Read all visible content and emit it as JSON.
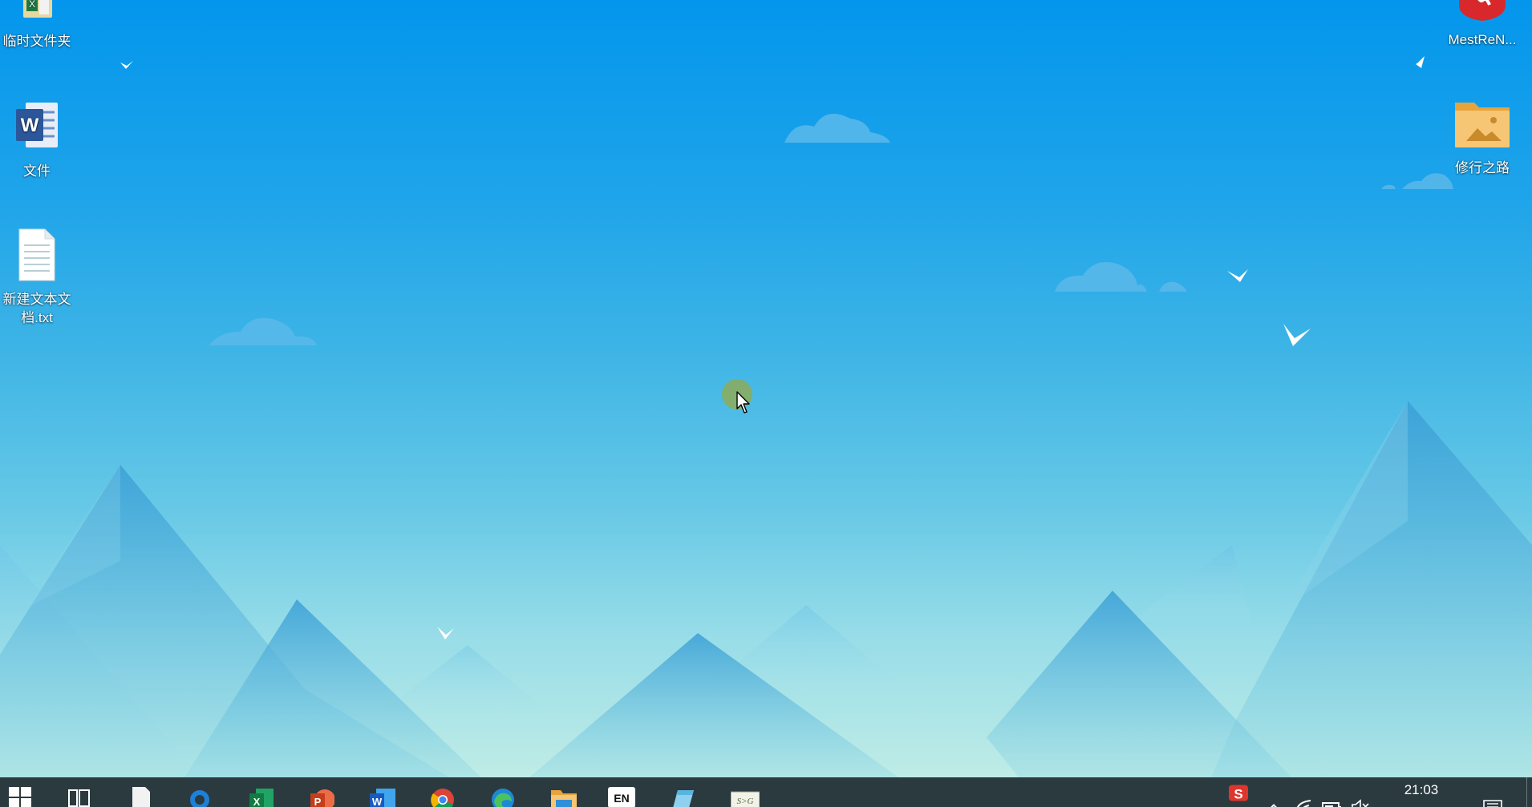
{
  "desktop": {
    "icons": [
      {
        "label": "临时文件夹",
        "icon": "folder-excel-icon"
      },
      {
        "label": "文件",
        "icon": "word-document-icon"
      },
      {
        "label": "新建文本文档.txt",
        "icon": "text-document-icon"
      },
      {
        "label": "MestReN...",
        "icon": "mestrenova-app-icon"
      },
      {
        "label": "修行之路",
        "icon": "picture-folder-icon"
      }
    ]
  },
  "taskbar": {
    "items": [
      {
        "name": "start-button",
        "icon": "windows-logo-icon"
      },
      {
        "name": "task-view-button",
        "icon": "task-view-icon"
      },
      {
        "name": "notepad-button",
        "icon": "notepad-icon"
      },
      {
        "name": "search-app-button",
        "icon": "search-circle-icon"
      },
      {
        "name": "excel-button",
        "icon": "excel-icon"
      },
      {
        "name": "powerpoint-button",
        "icon": "powerpoint-icon"
      },
      {
        "name": "word-button",
        "icon": "word-icon"
      },
      {
        "name": "chrome-button",
        "icon": "chrome-icon"
      },
      {
        "name": "edge-button",
        "icon": "edge-icon"
      },
      {
        "name": "file-explorer-button",
        "icon": "folder-icon"
      },
      {
        "name": "language-button",
        "icon": "keyboard-language-icon"
      },
      {
        "name": "app-button",
        "icon": "pen-app-icon"
      },
      {
        "name": "svg-app-button",
        "icon": "svg-app-icon"
      }
    ],
    "language": "EN",
    "svg_app_label": "S>G",
    "tray": {
      "ime": "sogou-ime-icon",
      "chevron": "chevron-up-icon",
      "network": "wifi-icon",
      "battery": "battery-icon",
      "volume": "volume-muted-icon",
      "notifications": "notification-icon"
    },
    "clock": "21:03"
  },
  "colors": {
    "sky_top": "#0396ec",
    "sky_bottom": "#bfece6",
    "taskbar": "#2b3a3f",
    "cursor_halo": "#96aa46"
  }
}
